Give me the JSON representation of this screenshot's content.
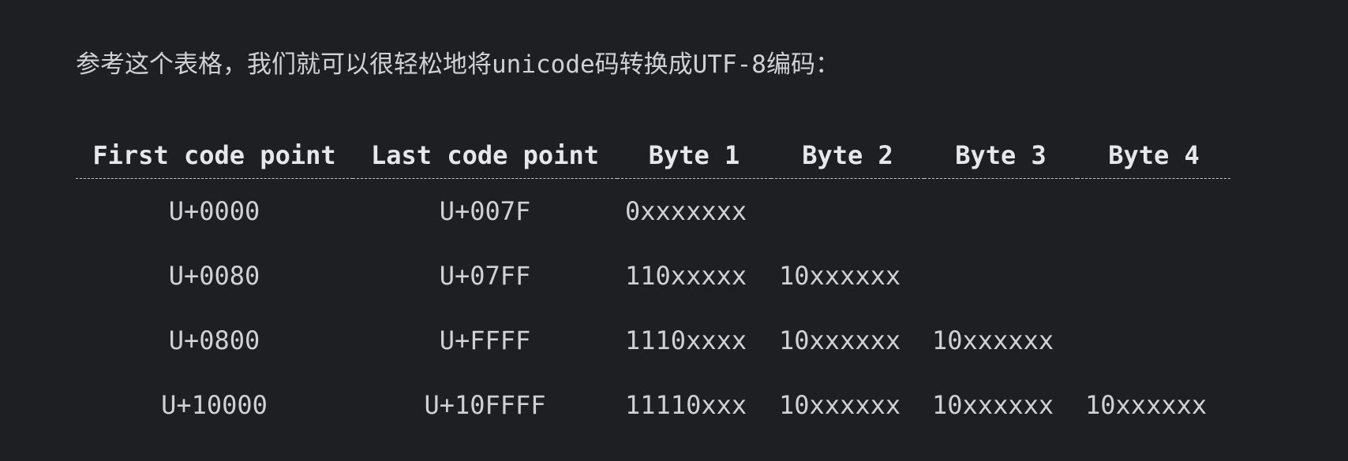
{
  "paragraph": "参考这个表格，我们就可以很轻松地将unicode码转换成UTF-8编码：",
  "table": {
    "headers": [
      "First code point",
      "Last code point",
      "Byte 1",
      "Byte 2",
      "Byte 3",
      "Byte 4"
    ],
    "rows": [
      [
        "U+0000",
        "U+007F",
        "0xxxxxxx",
        "",
        "",
        ""
      ],
      [
        "U+0080",
        "U+07FF",
        "110xxxxx",
        "10xxxxxx",
        "",
        ""
      ],
      [
        "U+0800",
        "U+FFFF",
        "1110xxxx",
        "10xxxxxx",
        "10xxxxxx",
        ""
      ],
      [
        "U+10000",
        "U+10FFFF",
        "11110xxx",
        "10xxxxxx",
        "10xxxxxx",
        "10xxxxxx"
      ]
    ]
  }
}
